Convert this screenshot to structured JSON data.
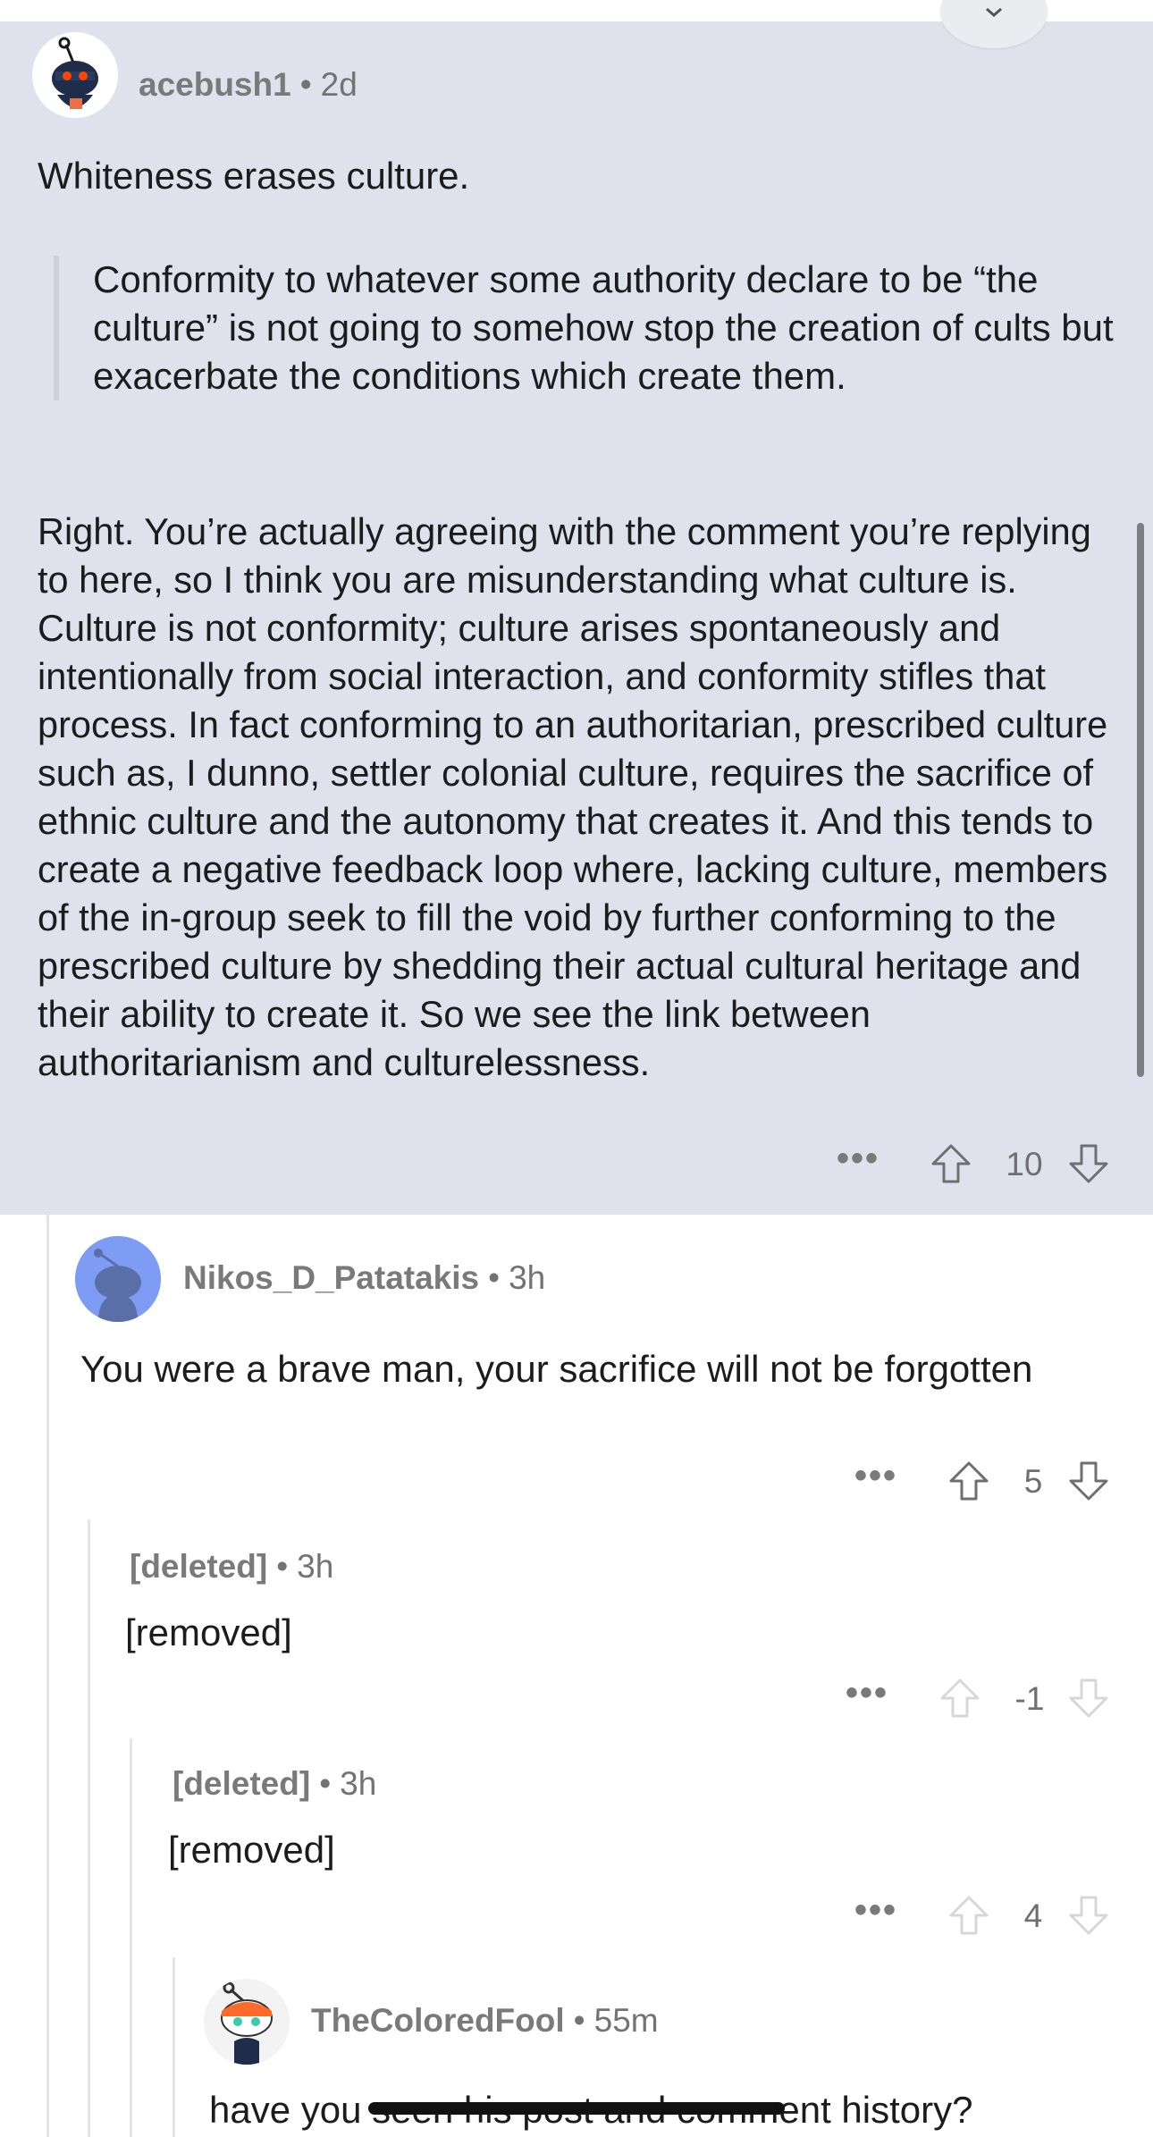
{
  "comments": [
    {
      "username": "acebush1",
      "age": "2d",
      "paragraphs": [
        "Whiteness erases culture."
      ],
      "quote": "Conformity to whatever some authority declare to be “the culture” is not going to somehow stop the creation of cults but exacerbate the conditions which create them.",
      "reply_text": "Right. You’re actually agreeing with the comment you’re replying to here, so I think you are misunderstanding what culture is. Culture is not conformity; culture arises spontaneously and intentionally from social interaction, and conformity stifles that process. In fact conforming to an authoritarian, prescribed culture such as, I dunno, settler colonial culture, requires the sacrifice of ethnic culture and the autonomy that creates it. And this tends to create a negative feedback loop where, lacking culture, members of the in-group seek to fill the void by further conforming to the prescribed culture by shedding their actual cultural heritage and their ability to create it. So we see the link between authoritarianism and culturelessness.",
      "score": "10",
      "more_label": "•••"
    },
    {
      "username": "Nikos_D_Patatakis",
      "age": "3h",
      "text": "You were a brave man, your sacrifice will not be forgotten",
      "score": "5",
      "more_label": "•••"
    },
    {
      "username": "[deleted]",
      "age": "3h",
      "text": "[removed]",
      "score": "-1",
      "more_label": "•••"
    },
    {
      "username": "[deleted]",
      "age": "3h",
      "text": "[removed]",
      "score": "4",
      "more_label": "•••"
    },
    {
      "username": "TheColoredFool",
      "age": "55m",
      "text": "have you seen his post and comment history?"
    }
  ],
  "separator": "•",
  "colors": {
    "highlight_bg": "#dfe2ec",
    "meta_text": "#737373",
    "avatar_blue": "#7f9cf5",
    "snoo_orange": "#ff4500"
  }
}
